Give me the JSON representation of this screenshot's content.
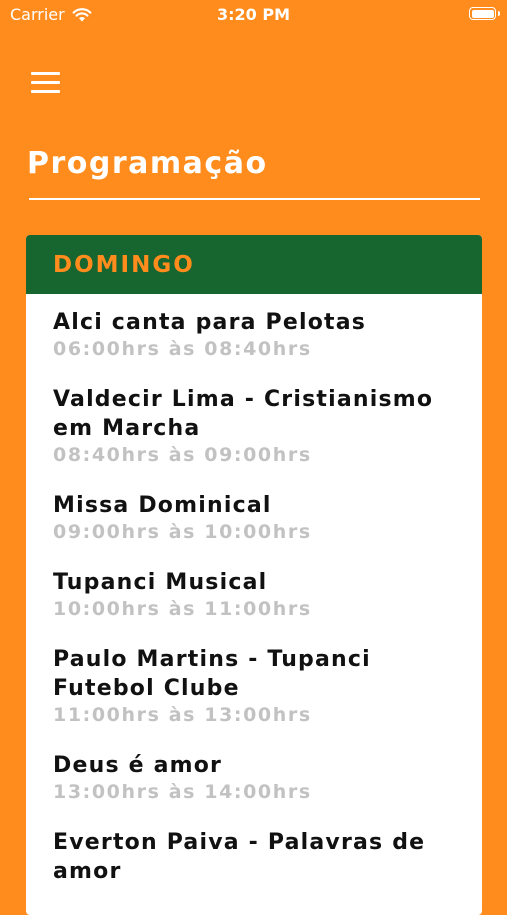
{
  "status_bar": {
    "carrier": "Carrier",
    "time": "3:20 PM",
    "icons": [
      "wifi-icon",
      "battery-icon"
    ]
  },
  "header": {
    "menu_icon": "menu-icon",
    "title": "Programação"
  },
  "colors": {
    "background": "#FF8C1C",
    "header_green": "#17652F",
    "day_text": "#FF8C1C",
    "time_gray": "#C2C2C2"
  },
  "schedule": {
    "day": "DOMINGO",
    "programs": [
      {
        "name": "Alci canta para Pelotas",
        "time": "06:00hrs às 08:40hrs"
      },
      {
        "name": "Valdecir Lima - Cristianismo em Marcha",
        "time": "08:40hrs às 09:00hrs"
      },
      {
        "name": "Missa Dominical",
        "time": "09:00hrs às 10:00hrs"
      },
      {
        "name": "Tupanci Musical",
        "time": "10:00hrs às 11:00hrs"
      },
      {
        "name": "Paulo Martins - Tupanci Futebol Clube",
        "time": "11:00hrs às 13:00hrs"
      },
      {
        "name": "Deus é amor",
        "time": "13:00hrs às 14:00hrs"
      },
      {
        "name": "Everton Paiva - Palavras de amor",
        "time": ""
      }
    ]
  }
}
